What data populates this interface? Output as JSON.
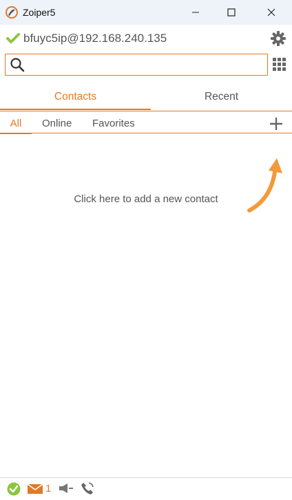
{
  "window": {
    "title": "Zoiper5",
    "minimize_icon": "minimize-icon",
    "maximize_icon": "maximize-icon",
    "close_icon": "close-icon"
  },
  "account": {
    "status_icon": "check-icon",
    "address": "bfuyc5ip@192.168.240.135",
    "settings_icon": "gear-icon"
  },
  "search": {
    "value": "",
    "placeholder": "",
    "icon": "search-icon",
    "dialpad_icon": "dialpad-icon"
  },
  "tabs": [
    {
      "label": "Contacts",
      "active": true
    },
    {
      "label": "Recent",
      "active": false
    }
  ],
  "filters": [
    {
      "label": "All",
      "active": true
    },
    {
      "label": "Online",
      "active": false
    },
    {
      "label": "Favorites",
      "active": false
    }
  ],
  "add_contact_icon": "plus-icon",
  "empty_state": {
    "hint": "Click here to add a new contact"
  },
  "statusbar": {
    "registration_icon": "check-circle-icon",
    "messages_icon": "envelope-icon",
    "message_count": "1",
    "speaker_icon": "speaker-icon",
    "phone_icon": "phone-icon"
  },
  "colors": {
    "accent": "#e07a25",
    "ok_green": "#8cc63f",
    "titlebar_bg": "#eef3f9"
  }
}
